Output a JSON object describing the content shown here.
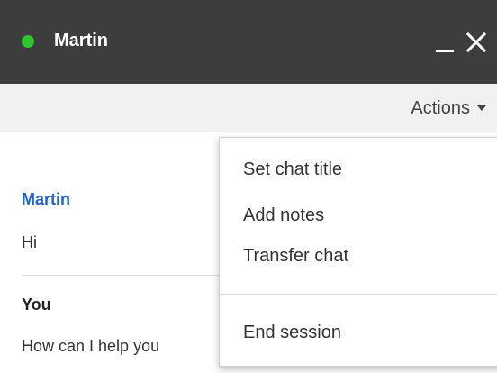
{
  "titlebar": {
    "name": "Martin",
    "status_color": "#2ec52e",
    "minimize_icon": "minimize-icon",
    "close_icon": "close-icon"
  },
  "actions_bar": {
    "actions_label": "Actions"
  },
  "messages": [
    {
      "sender": "Martin",
      "text": "Hi"
    },
    {
      "sender": "You",
      "text": "How can I help you"
    }
  ],
  "menu": {
    "items": [
      {
        "label": "Set chat title"
      },
      {
        "label": "Add notes"
      },
      {
        "label": "Transfer chat"
      },
      {
        "label": "End session"
      }
    ]
  },
  "colors": {
    "titlebar_bg": "#3d3d3d",
    "actions_bar_bg": "#f1f1f1",
    "agent_name": "#2166c4"
  }
}
